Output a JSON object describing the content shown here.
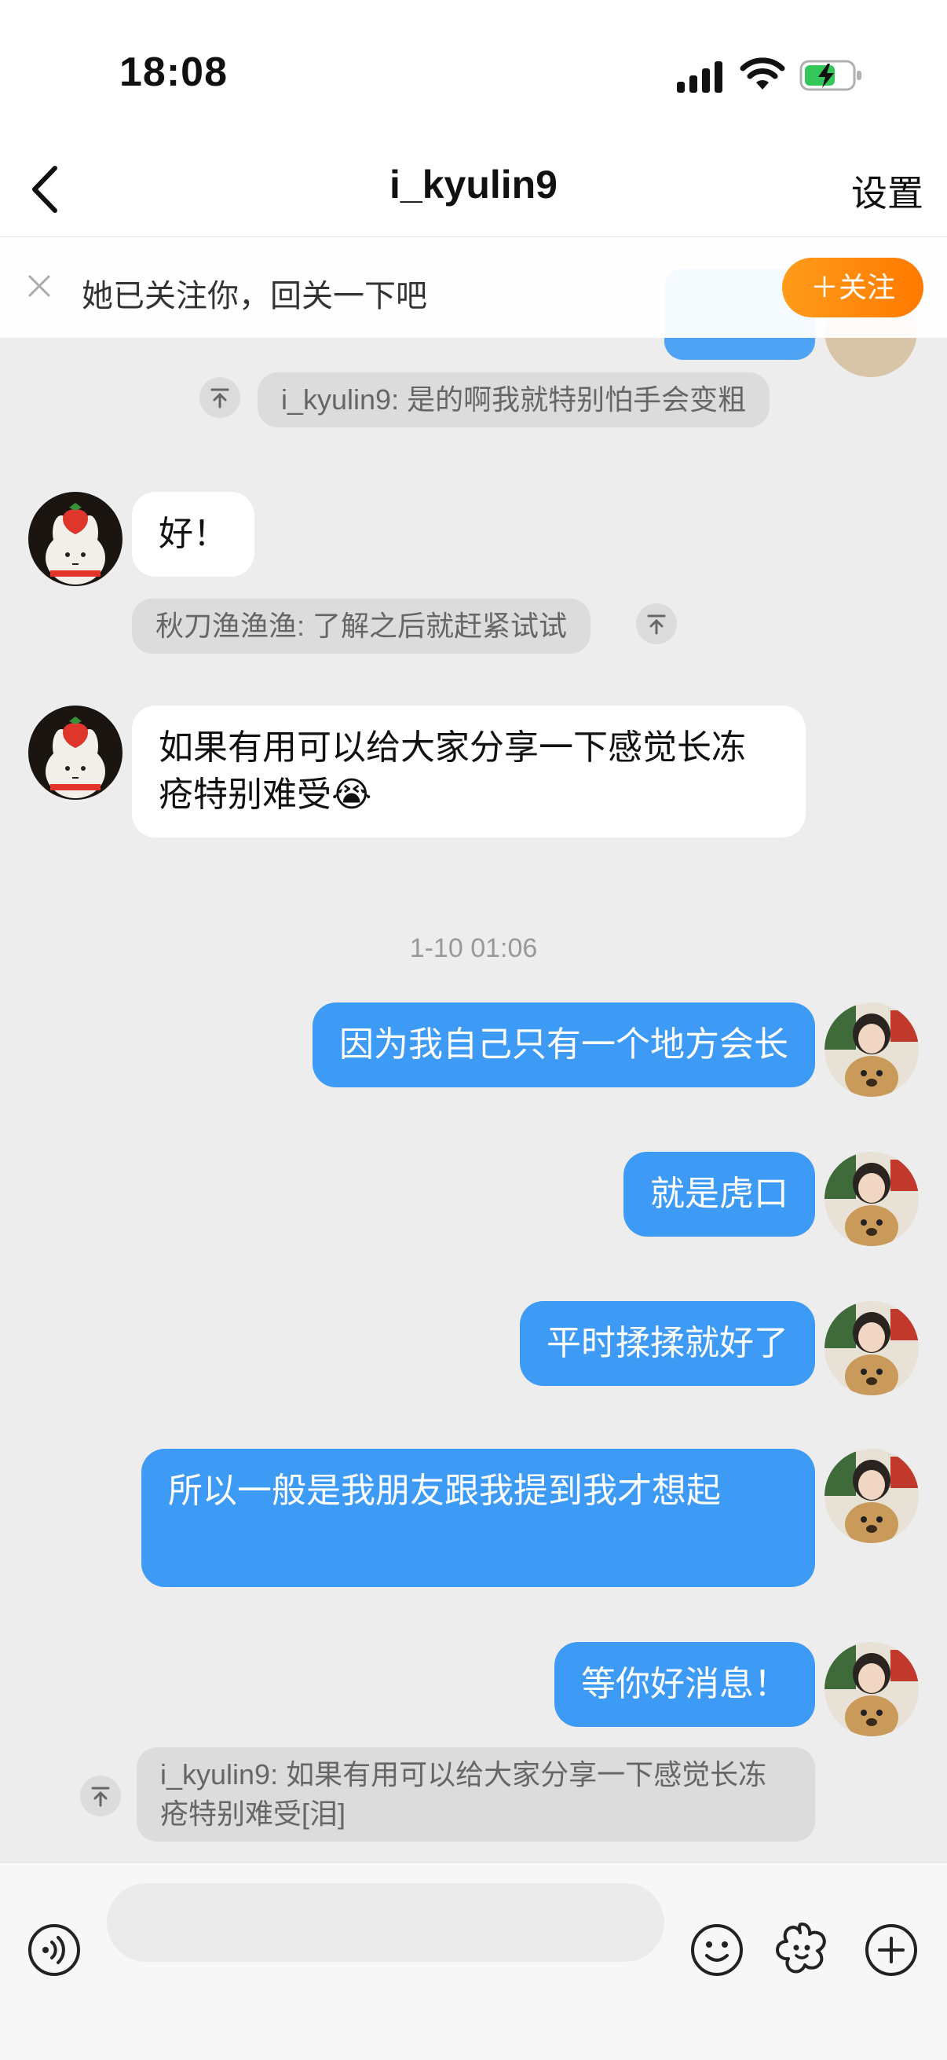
{
  "status_bar": {
    "time": "18:08"
  },
  "header": {
    "title": "i_kyulin9",
    "settings_label": "设置"
  },
  "follow_banner": {
    "text": "她已关注你，回关一下吧",
    "button_label": "＋关注"
  },
  "messages": {
    "quote_1": "i_kyulin9: 是的啊我就特别怕手会变粗",
    "in_1": "好！",
    "quote_2": "秋刀渔渔渔: 了解之后就赶紧试试",
    "in_2": "如果有用可以给大家分享一下感觉长冻疮特别难受😭",
    "timestamp": "1-10 01:06",
    "out_1": "因为我自己只有一个地方会长",
    "out_2": "就是虎口",
    "out_3": "平时揉揉就好了",
    "out_4": "所以一般是我朋友跟我提到我才想起",
    "out_5": "等你好消息！",
    "quote_3": "i_kyulin9: 如果有用可以给大家分享一下感觉长冻疮特别难受[泪]"
  },
  "colors": {
    "accent": "#3d9af5",
    "follow_button": "#ff8a00",
    "background": "#ededed"
  },
  "icons": [
    "back-icon",
    "close-icon",
    "quote-icon",
    "voice-icon",
    "emoji-icon",
    "sticker-icon",
    "plus-icon"
  ]
}
